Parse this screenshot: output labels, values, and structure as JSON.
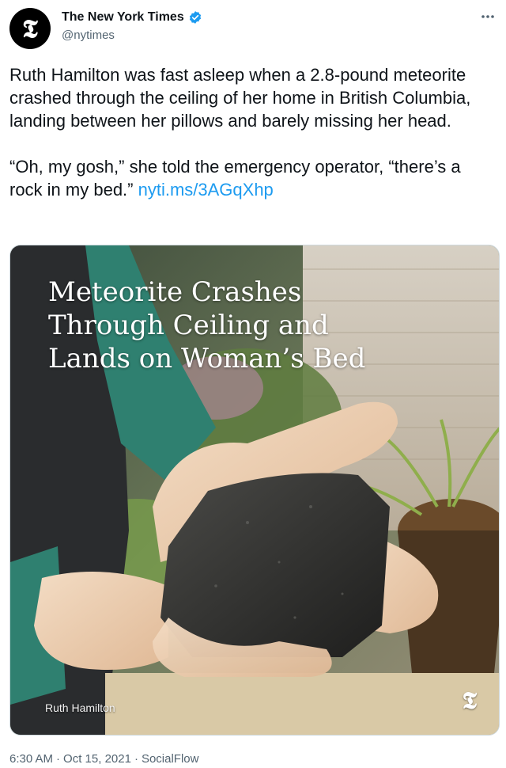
{
  "author": {
    "display_name": "The New York Times",
    "handle": "@nytimes",
    "avatar_glyph": "𝕿",
    "verified_color": "#1d9bf0"
  },
  "more_icon": "more-options-icon",
  "tweet": {
    "paragraph1": "Ruth Hamilton was fast asleep when a 2.8-pound meteorite crashed through the ceiling of her home in British Columbia, landing between her pillows and barely missing her head.",
    "paragraph2_text": "“Oh, my gosh,” she told the emergency operator, “there’s a rock in my bed.” ",
    "link": "nyti.ms/3AGqXhp"
  },
  "media": {
    "headline_lines": [
      "Meteorite Crashes",
      "Through Ceiling and",
      "Lands on Woman’s Bed"
    ],
    "credit": "Ruth Hamilton",
    "logo_glyph": "𝕿"
  },
  "meta": {
    "time": "6:30 AM",
    "sep1": "·",
    "date": "Oct 15, 2021",
    "sep2": "·",
    "source": "SocialFlow"
  },
  "colors": {
    "link": "#1d9bf0",
    "secondary_text": "#536471"
  }
}
